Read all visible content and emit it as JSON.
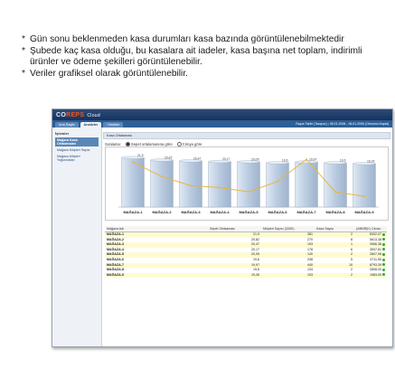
{
  "bullets": [
    "Gün sonu beklenmeden kasa durumları kasa bazında görüntülenebilmektedir",
    "Şubede kaç kasa olduğu, bu kasalara ait iadeler, kasa başına net toplam, indirimli ürünler ve ödeme şekilleri görüntülenebilir.",
    "Veriler grafiksel olarak görüntülenebilir."
  ],
  "app": {
    "logo_a": "CO",
    "logo_b": "REPS",
    "logo_c": "Cloud"
  },
  "nav": {
    "tabs": [
      "Ana Sayfa",
      "Analizler",
      "Yönetim"
    ],
    "active_tab": 1,
    "info": "Rapor Tarihi (Tarayıcı) • 05.01.2006 - 06.01.2006    (Oturumu Kapat)"
  },
  "sidebar": {
    "title": "İşlemler",
    "items": [
      "Mağaza Kasa Ortalamaları",
      "Mağaza Müşteri Sayısı",
      "Mağaza Müşteri Yoğunlukları"
    ],
    "active_index": 0
  },
  "panel": {
    "header": "Kasa Ortalaması",
    "sort_label": "Sıralama:",
    "radio1": "Sepet ortalamasına göre",
    "radio2": "Ciroya göre"
  },
  "chart_data": {
    "type": "bar",
    "categories": [
      "MAĞAZA-1",
      "MAĞAZA-2",
      "MAĞAZA-3",
      "MAĞAZA-4",
      "MAĞAZA-5",
      "MAĞAZA-6",
      "MAĞAZA-7",
      "MAĞAZA-8",
      "MAĞAZA-9"
    ],
    "bar_labels": [
      "21,9",
      "20,82",
      "20,47",
      "20,17",
      "20,05",
      "19,6",
      "19,97",
      "19,6",
      "19,26"
    ],
    "values": [
      21.9,
      20.82,
      20.47,
      20.17,
      20.05,
      19.6,
      19.97,
      19.6,
      19.26
    ],
    "line_values": [
      8302,
      5613,
      3956,
      3598,
      2807,
      4711,
      8793,
      2808,
      1983
    ],
    "colors": {
      "bar": "#b9cbe0",
      "bar_top": "#e4edf6",
      "line": "#e8b63a"
    }
  },
  "table": {
    "headers": [
      "Mağaza Adı",
      "Sepet Ortalaması",
      "Müşteri Sayısı (330K)",
      "Kasa Sayısı",
      "(ABNR(K) Cirosu"
    ],
    "rows": [
      [
        "MAĞAZA-1",
        "21,9",
        "381",
        "2",
        "8302,07"
      ],
      [
        "MAĞAZA-2",
        "20,82",
        "270",
        "8",
        "5613,38"
      ],
      [
        "MAĞAZA-3",
        "20,47",
        "193",
        "1",
        "3956,38"
      ],
      [
        "MAĞAZA-4",
        "20,17",
        "178",
        "6",
        "3597,81"
      ],
      [
        "MAĞAZA-5",
        "20,05",
        "140",
        "2",
        "2807,08"
      ],
      [
        "MAĞAZA-6",
        "19,6",
        "238",
        "5",
        "4711,55"
      ],
      [
        "MAĞAZA-7",
        "19,97",
        "440",
        "10",
        "8793,39"
      ],
      [
        "MAĞAZA-8",
        "19,6",
        "134",
        "2",
        "2808,00"
      ],
      [
        "MAĞAZA-9",
        "19,26",
        "103",
        "2",
        "1983,09"
      ]
    ]
  }
}
